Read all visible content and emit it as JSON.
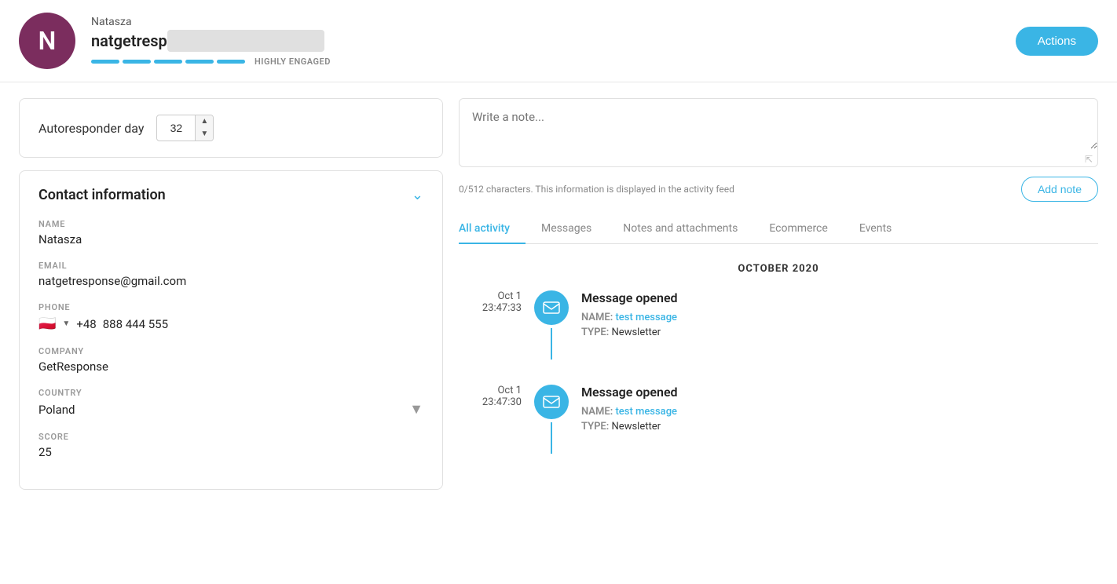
{
  "header": {
    "avatar_letter": "N",
    "avatar_bg": "#7b2d5e",
    "name": "Natasza",
    "email_prefix": "natgetresp",
    "engagement_label": "HIGHLY ENGAGED",
    "actions_button": "Actions"
  },
  "autoresponder": {
    "label": "Autoresponder day",
    "day_value": "32"
  },
  "contact_info": {
    "title": "Contact information",
    "fields": {
      "name_label": "NAME",
      "name_value": "Natasza",
      "email_label": "EMAIL",
      "email_value": "natgetresponse@gmail.com",
      "phone_label": "PHONE",
      "phone_prefix": "+48",
      "phone_number": "888 444 555",
      "company_label": "COMPANY",
      "company_value": "GetResponse",
      "country_label": "COUNTRY",
      "country_value": "Poland",
      "score_label": "SCORE",
      "score_value": "25"
    }
  },
  "note": {
    "placeholder": "Write a note...",
    "char_info": "0/512 characters. This information is displayed in the activity feed",
    "add_button": "Add note"
  },
  "tabs": [
    {
      "id": "all-activity",
      "label": "All activity",
      "active": true
    },
    {
      "id": "messages",
      "label": "Messages",
      "active": false
    },
    {
      "id": "notes-attachments",
      "label": "Notes and attachments",
      "active": false
    },
    {
      "id": "ecommerce",
      "label": "Ecommerce",
      "active": false
    },
    {
      "id": "events",
      "label": "Events",
      "active": false
    }
  ],
  "activity": {
    "month": "OCTOBER 2020",
    "items": [
      {
        "date": "Oct 1",
        "time": "23:47:33",
        "event": "Message opened",
        "name_label": "NAME:",
        "name_value": "test message",
        "type_label": "TYPE:",
        "type_value": "Newsletter"
      },
      {
        "date": "Oct 1",
        "time": "23:47:30",
        "event": "Message opened",
        "name_label": "NAME:",
        "name_value": "test message",
        "type_label": "TYPE:",
        "type_value": "Newsletter"
      }
    ]
  }
}
